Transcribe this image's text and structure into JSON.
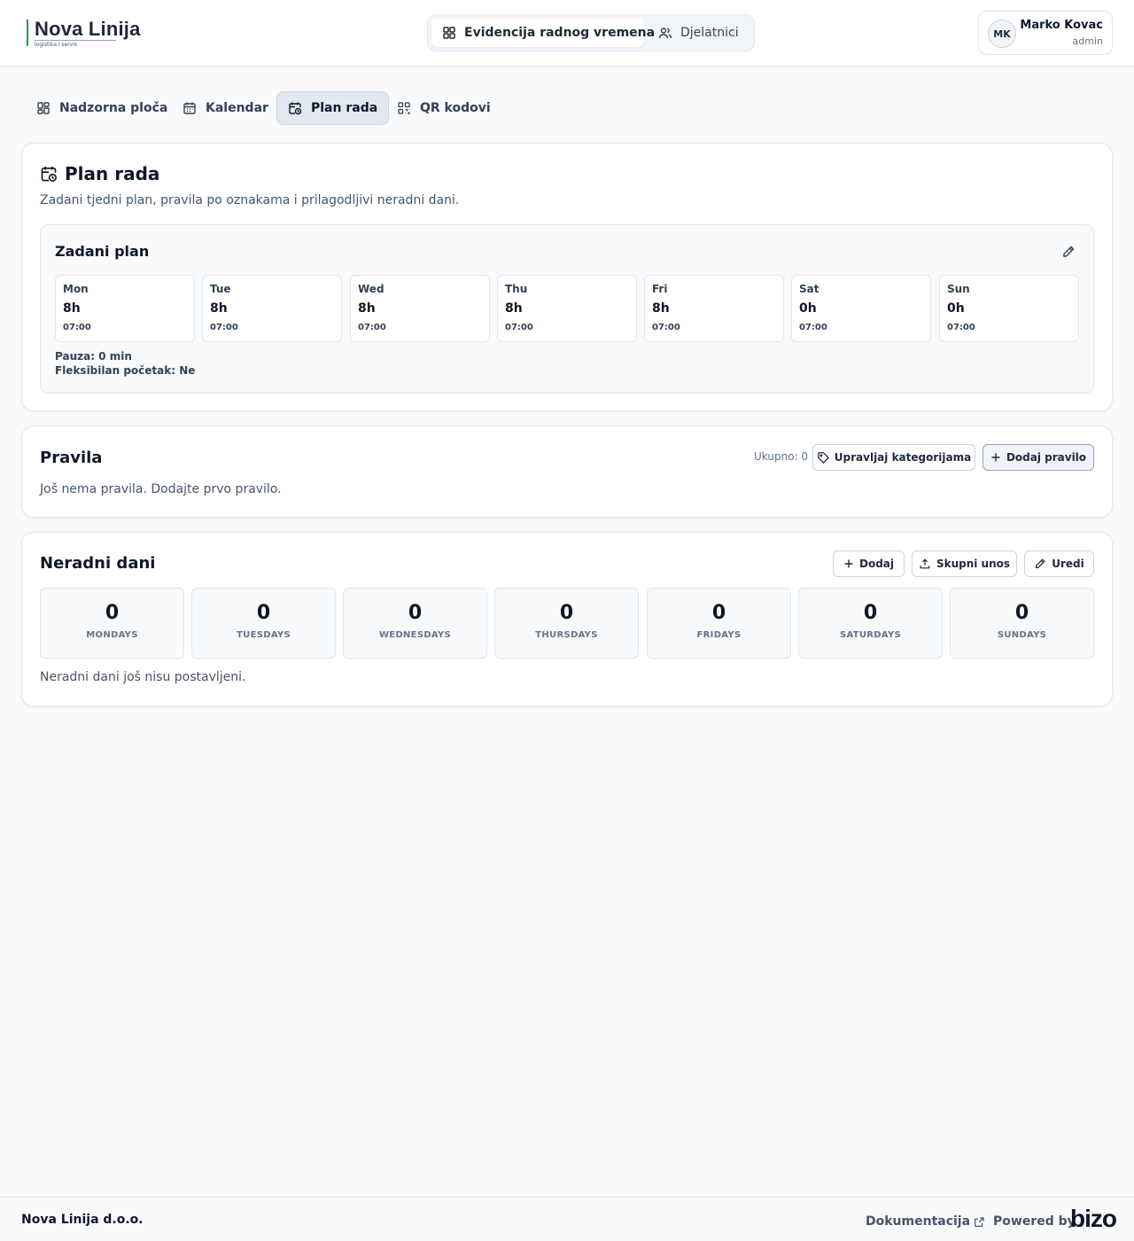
{
  "brand": {
    "name": "Nova Linija",
    "tagline": "logistika i servis",
    "accent": "#16a34a"
  },
  "appnav": {
    "items": [
      {
        "label": "Evidencija radnog vremena",
        "icon": "grid-icon",
        "active": true
      },
      {
        "label": "Djelatnici",
        "icon": "users-icon",
        "active": false
      }
    ]
  },
  "user": {
    "initials": "MK",
    "name": "Marko Kovac",
    "role": "admin"
  },
  "subnav": {
    "items": [
      {
        "label": "Nadzorna ploča",
        "icon": "dashboard-icon"
      },
      {
        "label": "Kalendar",
        "icon": "calendar-icon"
      },
      {
        "label": "Plan rada",
        "icon": "calendar-clock-icon",
        "active": true
      },
      {
        "label": "QR kodovi",
        "icon": "qr-icon"
      }
    ]
  },
  "plan": {
    "title": "Plan rada",
    "description": "Zadani tjedni plan, pravila po oznakama i prilagodljivi neradni dani.",
    "default_plan": {
      "title": "Zadani plan",
      "days": [
        {
          "name": "Mon",
          "hours": "8h",
          "start": "07:00"
        },
        {
          "name": "Tue",
          "hours": "8h",
          "start": "07:00"
        },
        {
          "name": "Wed",
          "hours": "8h",
          "start": "07:00"
        },
        {
          "name": "Thu",
          "hours": "8h",
          "start": "07:00"
        },
        {
          "name": "Fri",
          "hours": "8h",
          "start": "07:00"
        },
        {
          "name": "Sat",
          "hours": "0h",
          "start": "07:00"
        },
        {
          "name": "Sun",
          "hours": "0h",
          "start": "07:00"
        }
      ],
      "pause": "Pauza: 0 min",
      "flexible": "Fleksibilan početak: Ne"
    }
  },
  "rules": {
    "title": "Pravila",
    "count": "Ukupno: 0",
    "manage_label": "Upravljaj kategorijama",
    "add_label": "Dodaj pravilo",
    "empty": "Još nema pravila. Dodajte prvo pravilo."
  },
  "nonwork": {
    "title": "Neradni dani",
    "add_label": "Dodaj",
    "bulk_label": "Skupni unos",
    "edit_label": "Uredi",
    "counts": [
      {
        "value": "0",
        "label": "MONDAYS"
      },
      {
        "value": "0",
        "label": "TUESDAYS"
      },
      {
        "value": "0",
        "label": "WEDNESDAYS"
      },
      {
        "value": "0",
        "label": "THURSDAYS"
      },
      {
        "value": "0",
        "label": "FRIDAYS"
      },
      {
        "value": "0",
        "label": "SATURDAYS"
      },
      {
        "value": "0",
        "label": "SUNDAYS"
      }
    ],
    "empty": "Neradni dani još nisu postavljeni."
  },
  "footer": {
    "company": "Nova Linija d.o.o.",
    "docs_label": "Dokumentacija",
    "powered_label": "Powered by",
    "powered_brand": "bizo"
  }
}
